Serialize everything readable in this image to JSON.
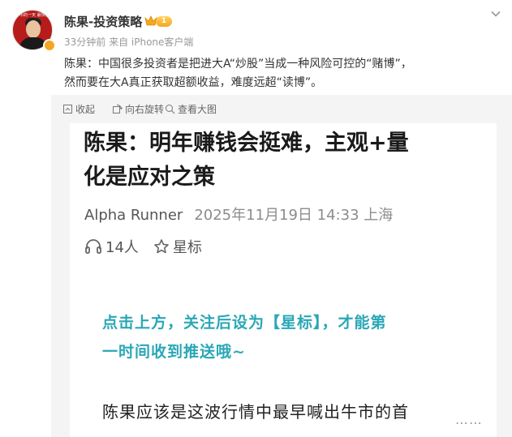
{
  "header": {
    "username": "陈果-投资策略",
    "vip_level": "1",
    "meta": "33分钟前  来自 iPhone客户端",
    "avatar_banner": "牛市的一天 最快让你赚大钱"
  },
  "post": {
    "line1": "陈果：中国很多投资者是把进大A“炒股”当成一种风险可控的“赌博”，",
    "line2": "然而要在大A真正获取超额收益，难度远超“读博”。"
  },
  "image_toolbar": {
    "collapse_label": "收起",
    "rotate_label": "向右旋转",
    "bigview_label": "查看大图"
  },
  "article": {
    "headline_line1": "陈果：明年赚钱会挺难，主观+量",
    "headline_line2": "化是应对之策",
    "author": "Alpha Runner",
    "datetime_location": "2025年11月19日 14:33 上海",
    "listeners": "14人",
    "star_label": "星标",
    "promo_line1": "点击上方，关注后设为【星标】，才能第",
    "promo_line2": "一时间收到推送哦~",
    "body_start": "陈果应该是这波行情中最早喊出牛市的首",
    "more_dots": "⋯⋯"
  },
  "icons": {
    "more": "chevron-down-icon",
    "collapse": "collapse-icon",
    "rotate": "rotate-icon",
    "bigview": "magnify-icon",
    "listen": "headphones-icon",
    "star": "star-icon"
  },
  "colors": {
    "accent_promo": "#2aa7b6",
    "vip_gold": "#f5a623",
    "avatar_red": "#b71c1c"
  }
}
